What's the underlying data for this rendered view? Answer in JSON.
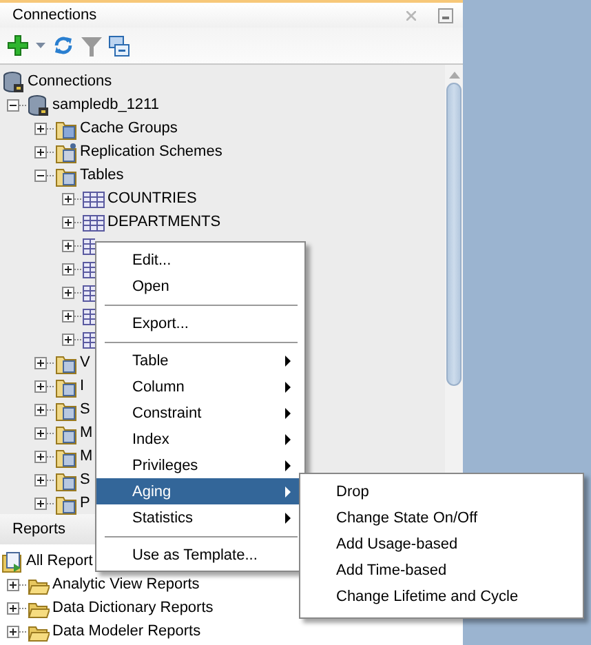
{
  "connections_panel": {
    "title": "Connections",
    "tree": [
      {
        "kind": "root",
        "label": "Connections",
        "children": [
          {
            "kind": "connection",
            "label": "sampledb_1211",
            "expanded": true,
            "children": [
              {
                "kind": "cache",
                "label": "Cache Groups",
                "expanded": false
              },
              {
                "kind": "replication",
                "label": "Replication Schemes",
                "expanded": false
              },
              {
                "kind": "folder",
                "label": "Tables",
                "expanded": true,
                "children": [
                  {
                    "kind": "table",
                    "label": "COUNTRIES",
                    "expanded": false
                  },
                  {
                    "kind": "table",
                    "label": "DEPARTMENTS",
                    "expanded": false
                  },
                  {
                    "kind": "table",
                    "expanded": false
                  },
                  {
                    "kind": "table",
                    "expanded": false
                  },
                  {
                    "kind": "table",
                    "expanded": false
                  },
                  {
                    "kind": "table",
                    "expanded": false
                  },
                  {
                    "kind": "table",
                    "expanded": false
                  }
                ]
              },
              {
                "kind": "folder",
                "label": "V",
                "expanded": false
              },
              {
                "kind": "folder",
                "label": "I",
                "expanded": false
              },
              {
                "kind": "folder",
                "label": "S",
                "expanded": false
              },
              {
                "kind": "folder",
                "label": "M",
                "expanded": false
              },
              {
                "kind": "folder",
                "label": "M",
                "expanded": false
              },
              {
                "kind": "folder",
                "label": "S",
                "expanded": false
              },
              {
                "kind": "folder",
                "label": "P",
                "expanded": false
              }
            ]
          }
        ]
      }
    ]
  },
  "reports_panel": {
    "title": "Reports",
    "tree": [
      {
        "kind": "reports",
        "label": "All Report",
        "children": [
          {
            "kind": "report-folder",
            "label": "Analytic View Reports",
            "expanded": false
          },
          {
            "kind": "report-folder",
            "label": "Data Dictionary Reports",
            "expanded": false
          },
          {
            "kind": "report-folder",
            "label": "Data Modeler Reports",
            "expanded": false
          }
        ]
      }
    ]
  },
  "context_menu": [
    {
      "kind": "item",
      "label": "Edit...",
      "submenu": false,
      "selected": false
    },
    {
      "kind": "item",
      "label": "Open",
      "submenu": false,
      "selected": false
    },
    {
      "kind": "separator"
    },
    {
      "kind": "item",
      "label": "Export...",
      "submenu": false,
      "selected": false
    },
    {
      "kind": "separator"
    },
    {
      "kind": "item",
      "label": "Table",
      "submenu": true,
      "selected": false
    },
    {
      "kind": "item",
      "label": "Column",
      "submenu": true,
      "selected": false
    },
    {
      "kind": "item",
      "label": "Constraint",
      "submenu": true,
      "selected": false
    },
    {
      "kind": "item",
      "label": "Index",
      "submenu": true,
      "selected": false
    },
    {
      "kind": "item",
      "label": "Privileges",
      "submenu": true,
      "selected": false
    },
    {
      "kind": "item",
      "label": "Aging",
      "submenu": true,
      "selected": true
    },
    {
      "kind": "item",
      "label": "Statistics",
      "submenu": true,
      "selected": false
    },
    {
      "kind": "separator"
    },
    {
      "kind": "item",
      "label": "Use as Template...",
      "submenu": false,
      "selected": false
    }
  ],
  "aging_submenu": [
    {
      "kind": "item",
      "label": "Drop",
      "submenu": false,
      "selected": false
    },
    {
      "kind": "item",
      "label": "Change State On/Off",
      "submenu": false,
      "selected": false
    },
    {
      "kind": "item",
      "label": "Add Usage-based",
      "submenu": false,
      "selected": false
    },
    {
      "kind": "item",
      "label": "Add Time-based",
      "submenu": false,
      "selected": false
    },
    {
      "kind": "item",
      "label": "Change Lifetime and Cycle",
      "submenu": false,
      "selected": false
    }
  ]
}
